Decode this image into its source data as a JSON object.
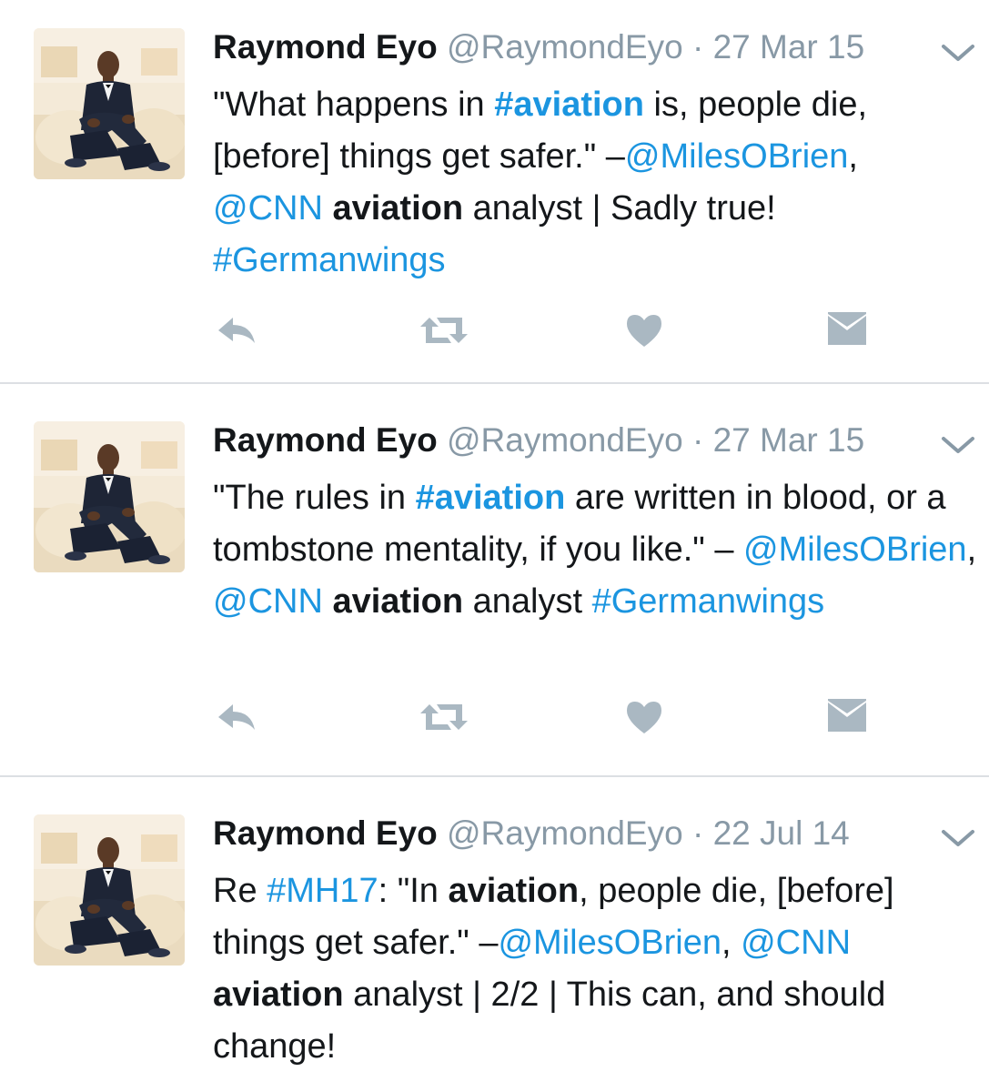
{
  "colors": {
    "link": "#1b95e0",
    "muted": "#8899a6",
    "text": "#14171a",
    "icon": "#aab8c2",
    "divider": "#dcdfe3"
  },
  "tweets": [
    {
      "name": "Raymond Eyo",
      "handle": "@RaymondEyo",
      "separator": "·",
      "date": "27 Mar 15",
      "segments": [
        {
          "text": "\"What happens in ",
          "style": "plain"
        },
        {
          "text": "#aviation",
          "style": "hash-bold"
        },
        {
          "text": " is, people die, [before] things get safer.\" –",
          "style": "plain"
        },
        {
          "text": "@MilesOBrien",
          "style": "link"
        },
        {
          "text": ", ",
          "style": "plain"
        },
        {
          "text": "@CNN",
          "style": "link"
        },
        {
          "text": " ",
          "style": "plain"
        },
        {
          "text": "aviation",
          "style": "kw"
        },
        {
          "text": " analyst | Sadly true! ",
          "style": "plain"
        },
        {
          "text": "#Germanwings",
          "style": "link"
        }
      ],
      "actions": [
        "reply-icon",
        "retweet-icon",
        "like-icon",
        "direct-message-icon"
      ]
    },
    {
      "name": "Raymond Eyo",
      "handle": "@RaymondEyo",
      "separator": "·",
      "date": "27 Mar 15",
      "segments": [
        {
          "text": "\"The rules in ",
          "style": "plain"
        },
        {
          "text": "#aviation",
          "style": "hash-bold"
        },
        {
          "text": " are written in blood, or a tombstone mentality, if you like.\" – ",
          "style": "plain"
        },
        {
          "text": "@MilesOBrien",
          "style": "link"
        },
        {
          "text": ", ",
          "style": "plain"
        },
        {
          "text": "@CNN",
          "style": "link"
        },
        {
          "text": " ",
          "style": "plain"
        },
        {
          "text": "aviation",
          "style": "kw"
        },
        {
          "text": " analyst ",
          "style": "plain"
        },
        {
          "text": "#Germanwings",
          "style": "link"
        }
      ],
      "actions": [
        "reply-icon",
        "retweet-icon",
        "like-icon",
        "direct-message-icon"
      ]
    },
    {
      "name": "Raymond Eyo",
      "handle": "@RaymondEyo",
      "separator": "·",
      "date": "22 Jul 14",
      "segments": [
        {
          "text": "Re ",
          "style": "plain"
        },
        {
          "text": "#MH17",
          "style": "link"
        },
        {
          "text": ": \"In ",
          "style": "plain"
        },
        {
          "text": "aviation",
          "style": "kw"
        },
        {
          "text": ", people die, [before] things get safer.\" –",
          "style": "plain"
        },
        {
          "text": "@MilesOBrien",
          "style": "link"
        },
        {
          "text": ", ",
          "style": "plain"
        },
        {
          "text": "@CNN",
          "style": "link"
        },
        {
          "text": " ",
          "style": "plain"
        },
        {
          "text": "aviation",
          "style": "kw"
        },
        {
          "text": " analyst | 2/2 | This can, and should change!",
          "style": "plain"
        }
      ],
      "actions": []
    }
  ]
}
